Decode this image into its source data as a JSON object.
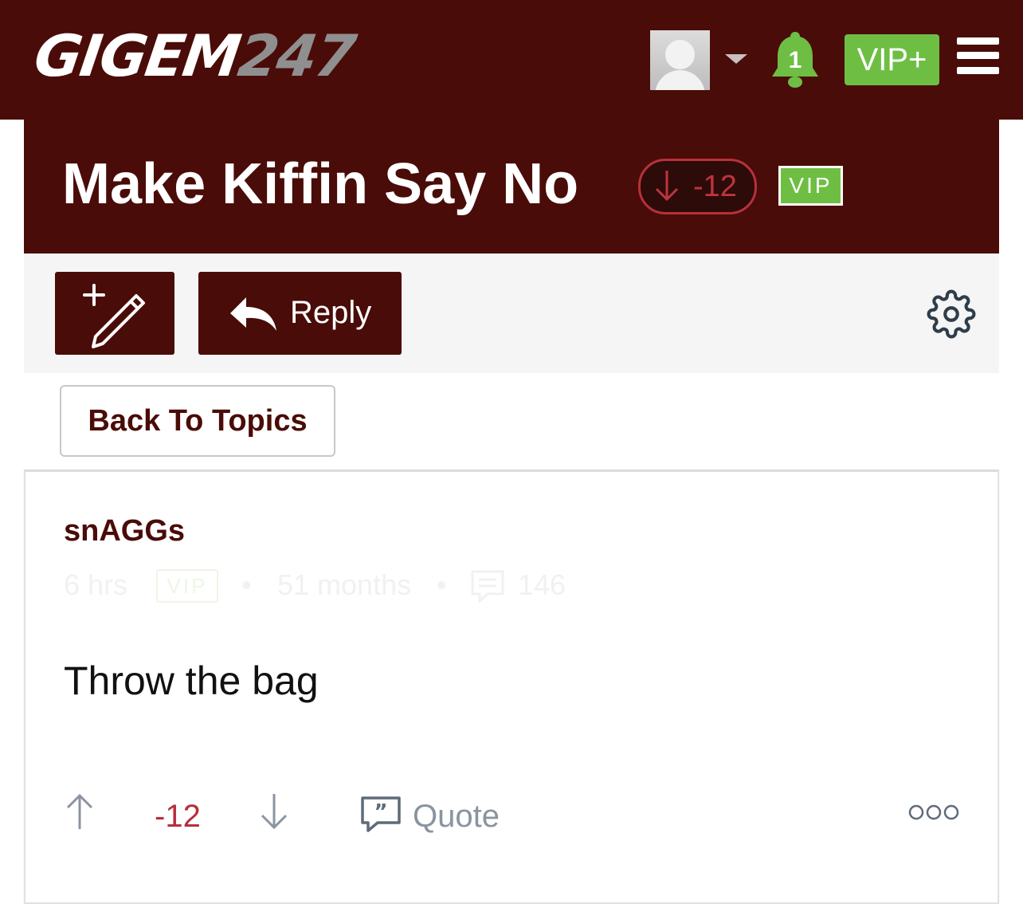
{
  "header": {
    "logo_main": "GIGEM",
    "logo_num": "247",
    "notification_count": "1",
    "vip_plus_label": "VIP+"
  },
  "thread": {
    "title": "Make Kiffin Say No",
    "vote_score": "-12",
    "vip_badge": "VIP"
  },
  "toolbar": {
    "reply_label": "Reply"
  },
  "nav": {
    "back_label": "Back To Topics"
  },
  "post": {
    "author": "snAGGs",
    "time": "6 hrs",
    "vip_badge": "VIP",
    "member_duration": "51 months",
    "post_count": "146",
    "dot": "•",
    "body": "Throw the bag",
    "score": "-12",
    "quote_label": "Quote",
    "more_label": "OOO"
  },
  "colors": {
    "brand_maroon": "#4a0c08",
    "vip_green": "#6fbe44",
    "negative_red": "#b52f3b",
    "action_gray": "#8a94a0"
  }
}
